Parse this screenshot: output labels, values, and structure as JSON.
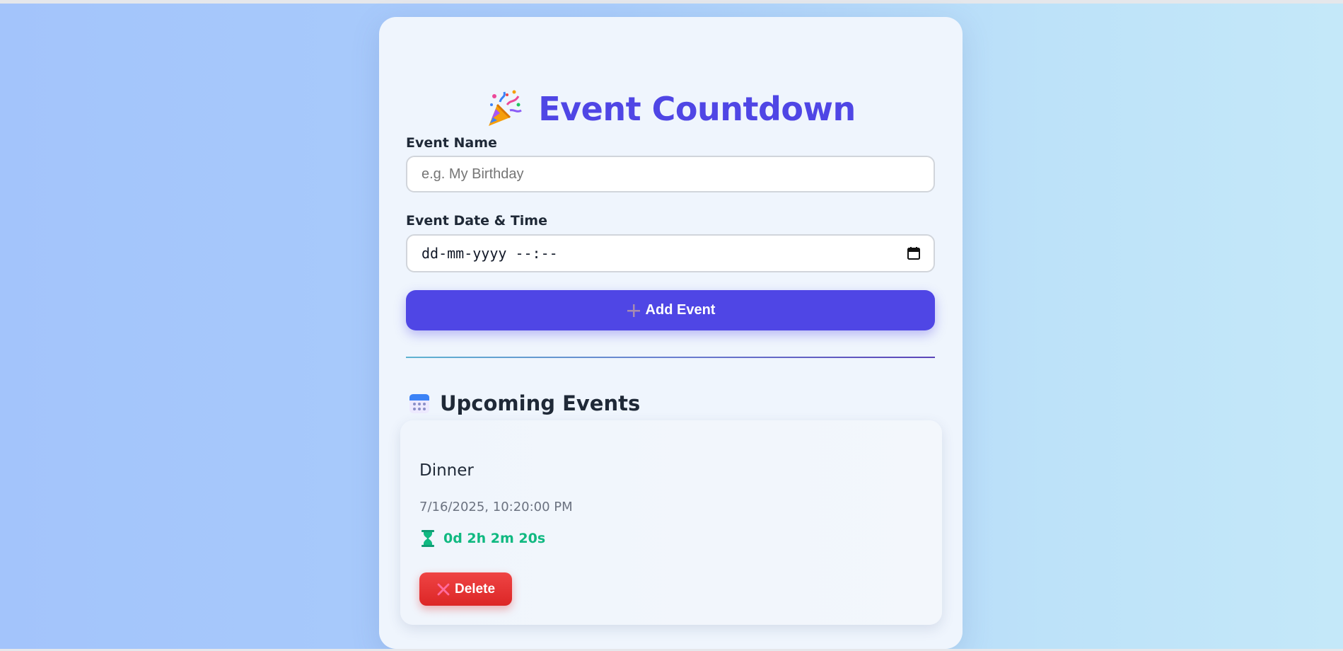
{
  "app": {
    "title": "Event Countdown",
    "title_icon": "party-popper-icon",
    "accent_color": "#4f46e5"
  },
  "form": {
    "name_label": "Event Name",
    "name_placeholder": "e.g. My Birthday",
    "name_value": "",
    "date_label": "Event Date & Time",
    "date_placeholder": "dd-mm-yyyy --:--",
    "date_value": "",
    "add_button_label": "Add Event",
    "add_button_icon": "plus-icon"
  },
  "upcoming": {
    "title": "Upcoming Events",
    "title_icon": "calendar-icon",
    "events": [
      {
        "name": "Dinner",
        "datetime": "7/16/2025, 10:20:00 PM",
        "countdown": "0d 2h 2m 20s",
        "countdown_icon": "hourglass-icon",
        "delete_label": "Delete",
        "delete_icon": "x-icon"
      }
    ]
  },
  "colors": {
    "countdown": "#10b981",
    "delete": "#dc2626",
    "page_gradient_start": "#a3c4fb",
    "page_gradient_end": "#c4e8f9"
  }
}
